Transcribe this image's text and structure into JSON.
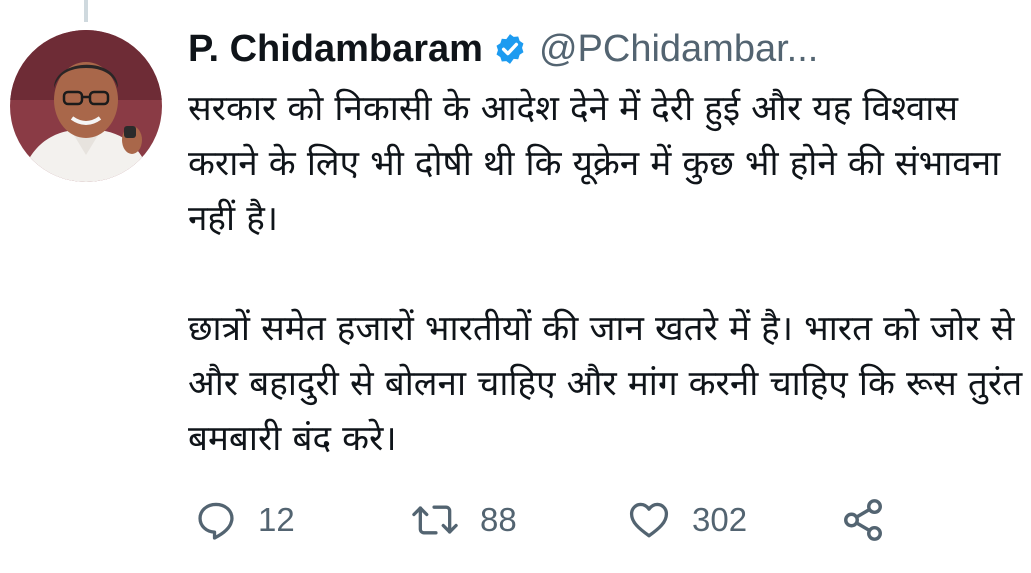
{
  "tweet": {
    "author_name": "P. Chidambaram",
    "author_handle": "@PChidambar...",
    "verified": true,
    "paragraphs": [
      "सरकार को निकासी के आदेश देने में देरी हुई और यह विश्वास कराने के लिए भी दोषी थी कि यूक्रेन में कुछ भी होने की संभावना नहीं है।",
      "छात्रों समेत हजारों भारतीयों की जान खतरे में है।  भारत को जोर से और बहादुरी से बोलना चाहिए और मांग करनी चाहिए कि रूस तुरंत बमबारी बंद करे।"
    ]
  },
  "actions": {
    "reply": {
      "icon": "reply-icon",
      "count": "12"
    },
    "retweet": {
      "icon": "retweet-icon",
      "count": "88"
    },
    "like": {
      "icon": "heart-icon",
      "count": "302"
    },
    "share": {
      "icon": "share-icon"
    }
  },
  "colors": {
    "text_primary": "#0f1419",
    "text_secondary": "#536471",
    "verified_blue": "#1d9bf0",
    "thread_line": "#cfd9de",
    "background": "#ffffff"
  }
}
